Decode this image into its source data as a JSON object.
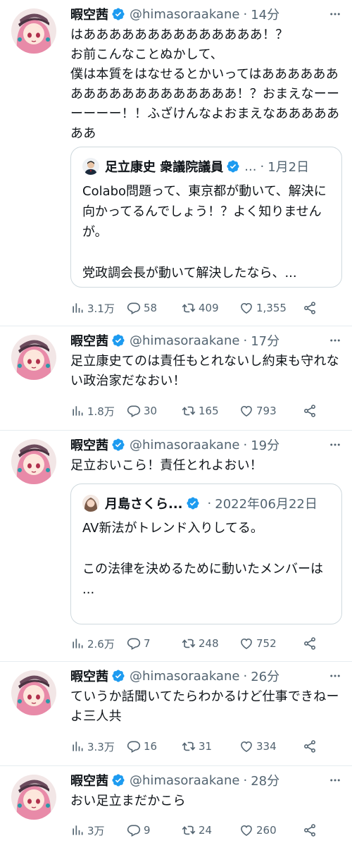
{
  "author": {
    "name": "暇空茜",
    "handle": "@himasoraakane",
    "avatar": "anime-girl-avatar",
    "verified": "verified-badge-icon"
  },
  "colors": {
    "verified": "#1d9bf0",
    "secondary_text": "#536471",
    "border": "#cfd9de"
  },
  "tweets": [
    {
      "time": "14分",
      "text": "はああああああああああああああ！？\nお前こんなことぬかして、\n僕は本質をはなせるとかいってはあああああああああああああああああああ！？おまえなーーーーーー！！ふざけんなよおまえなあああああああ",
      "quote": {
        "name": "足立康史 衆議院議員",
        "ellipsis": "...",
        "date": "1月2日",
        "text": "Colabo問題って、東京都が動いて、解決に向かってるんでしょう！？よく知りませんが。\n\n党政調会長が動いて解決したなら、..."
      },
      "views": "3.1万",
      "replies": "58",
      "retweets": "409",
      "likes": "1,355"
    },
    {
      "time": "17分",
      "text": "足立康史てのは責任もとれないし約束も守れない政治家だなおい！",
      "views": "1.8万",
      "replies": "30",
      "retweets": "165",
      "likes": "793"
    },
    {
      "time": "19分",
      "text": "足立おいこら！責任とれよおい！",
      "quote": {
        "name": "月島さくら...",
        "date": "2022年06月22日",
        "text": "AV新法がトレンド入りしてる。\n\nこの法律を決めるために動いたメンバーは\n..."
      },
      "views": "2.6万",
      "replies": "7",
      "retweets": "248",
      "likes": "752"
    },
    {
      "time": "26分",
      "text": "ていうか話聞いてたらわかるけど仕事できねーよ三人共",
      "views": "3.3万",
      "replies": "16",
      "retweets": "31",
      "likes": "334"
    },
    {
      "time": "28分",
      "text": "おい足立まだかこら",
      "views": "3万",
      "replies": "9",
      "retweets": "24",
      "likes": "260"
    }
  ]
}
